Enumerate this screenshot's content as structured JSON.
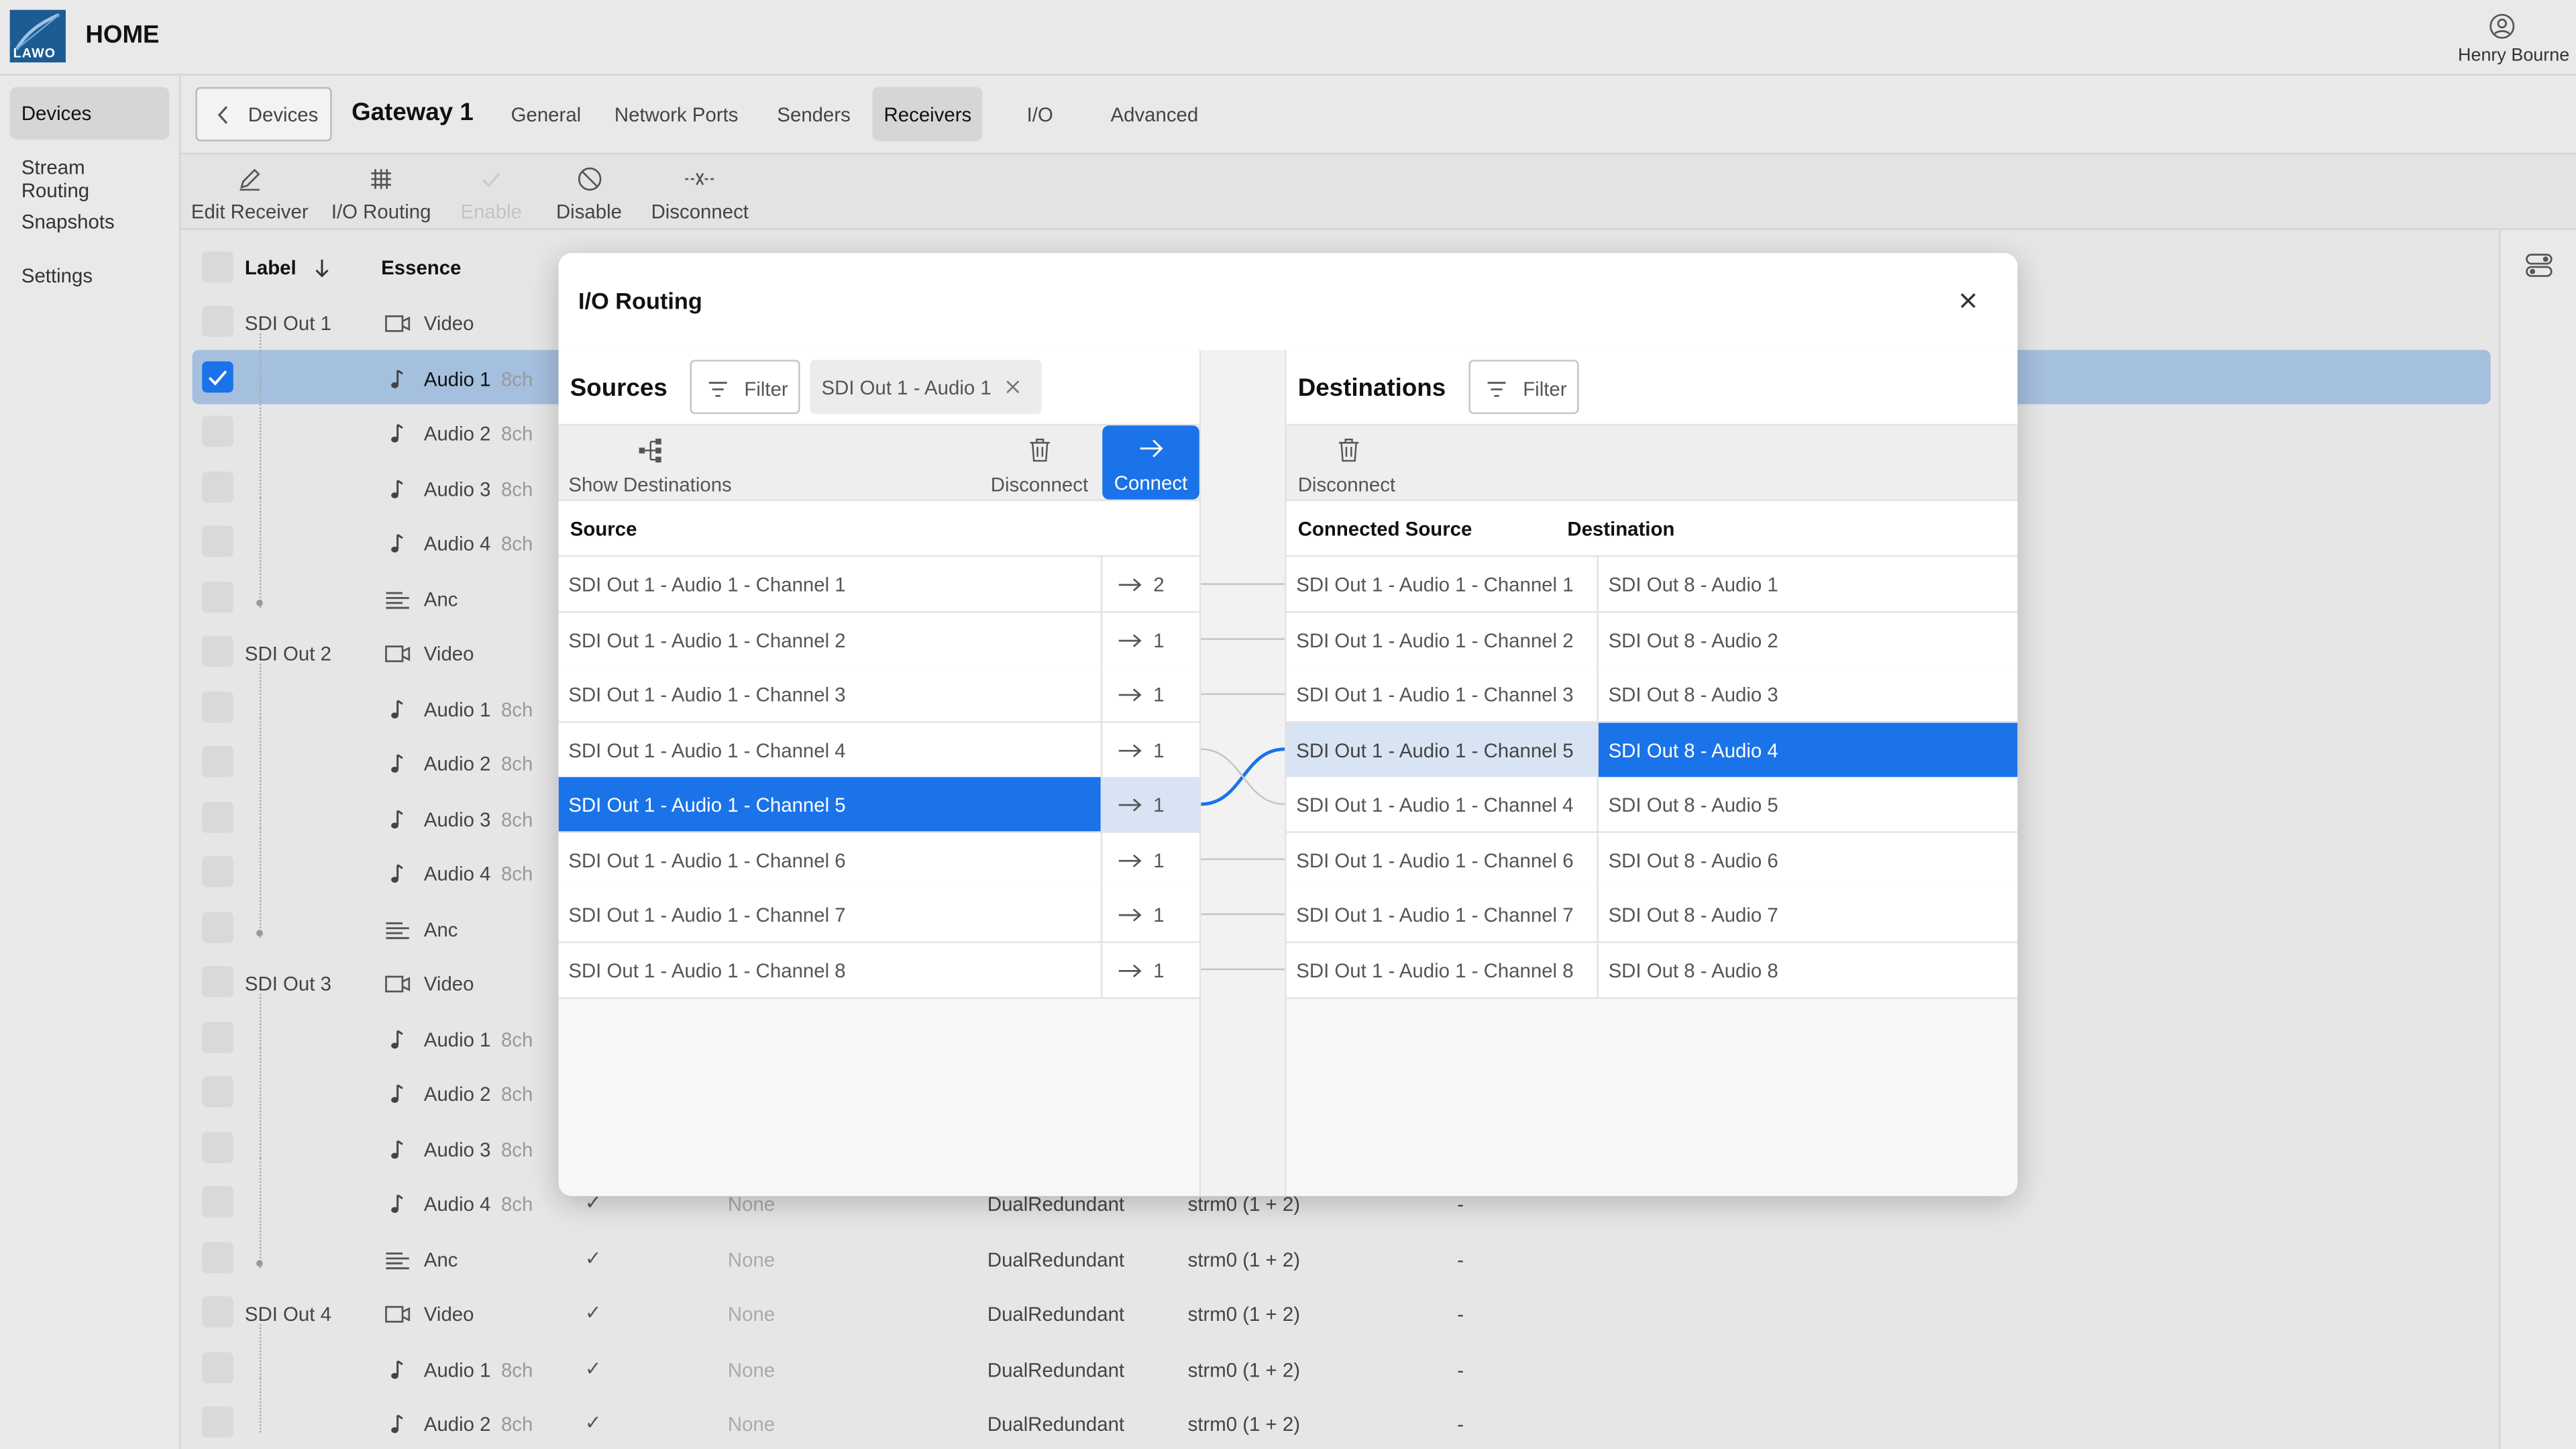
{
  "app": {
    "home_label": "HOME",
    "logo_text": "LAWO",
    "user_name": "Henry Bourne",
    "accent": "#1a73e8",
    "logo_color": "#1c5c93"
  },
  "sidebar": {
    "items": [
      {
        "label": "Devices",
        "active": true
      },
      {
        "label": "Stream Routing"
      },
      {
        "label": "Snapshots"
      },
      {
        "label": "Settings"
      }
    ]
  },
  "tabbar": {
    "back_label": "Devices",
    "device_title": "Gateway 1",
    "tabs": [
      {
        "label": "General"
      },
      {
        "label": "Network Ports"
      },
      {
        "label": "Senders"
      },
      {
        "label": "Receivers",
        "active": true
      },
      {
        "label": "I/O"
      },
      {
        "label": "Advanced"
      }
    ]
  },
  "toolbar": {
    "edit_receiver": "Edit Receiver",
    "io_routing": "I/O Routing",
    "enable": "Enable",
    "disable": "Disable",
    "disconnect": "Disconnect"
  },
  "table": {
    "headers": {
      "label": "Label",
      "essence": "Essence"
    },
    "rows": [
      {
        "label": "SDI Out 1",
        "essence": "Video"
      },
      {
        "essence": "Audio 1",
        "ch": "8ch",
        "selected": true
      },
      {
        "essence": "Audio 2",
        "ch": "8ch"
      },
      {
        "essence": "Audio 3",
        "ch": "8ch"
      },
      {
        "essence": "Audio 4",
        "ch": "8ch"
      },
      {
        "essence": "Anc"
      },
      {
        "label": "SDI Out 2",
        "essence": "Video"
      },
      {
        "essence": "Audio 1",
        "ch": "8ch"
      },
      {
        "essence": "Audio 2",
        "ch": "8ch"
      },
      {
        "essence": "Audio 3",
        "ch": "8ch"
      },
      {
        "essence": "Audio 4",
        "ch": "8ch"
      },
      {
        "essence": "Anc"
      },
      {
        "label": "SDI Out 3",
        "essence": "Video"
      },
      {
        "essence": "Audio 1",
        "ch": "8ch"
      },
      {
        "essence": "Audio 2",
        "ch": "8ch"
      },
      {
        "essence": "Audio 3",
        "ch": "8ch"
      },
      {
        "essence": "Audio 4",
        "ch": "8ch",
        "check": "✓",
        "none": "None",
        "mode": "DualRedundant",
        "stream": "strm0 (1 + 2)",
        "dash": "-"
      },
      {
        "essence": "Anc",
        "check": "✓",
        "none": "None",
        "mode": "DualRedundant",
        "stream": "strm0 (1 + 2)",
        "dash": "-"
      },
      {
        "label": "SDI Out 4",
        "essence": "Video",
        "check": "✓",
        "none": "None",
        "mode": "DualRedundant",
        "stream": "strm0 (1 + 2)",
        "dash": "-"
      },
      {
        "essence": "Audio 1",
        "ch": "8ch",
        "check": "✓",
        "none": "None",
        "mode": "DualRedundant",
        "stream": "strm0 (1 + 2)",
        "dash": "-"
      },
      {
        "essence": "Audio 2",
        "ch": "8ch",
        "check": "✓",
        "none": "None",
        "mode": "DualRedundant",
        "stream": "strm0 (1 + 2)",
        "dash": "-"
      }
    ]
  },
  "dialog": {
    "title": "I/O Routing",
    "sources": {
      "title": "Sources",
      "filter_label": "Filter",
      "chip_label": "SDI Out 1 - Audio 1",
      "show_destinations": "Show Destinations",
      "disconnect": "Disconnect",
      "connect": "Connect",
      "col_source": "Source",
      "rows": [
        {
          "name": "SDI Out 1 - Audio 1 - Channel 1",
          "count": "2"
        },
        {
          "name": "SDI Out 1 - Audio 1 - Channel 2",
          "count": "1"
        },
        {
          "name": "SDI Out 1 - Audio 1 - Channel 3",
          "count": "1"
        },
        {
          "name": "SDI Out 1 - Audio 1 - Channel 4",
          "count": "1"
        },
        {
          "name": "SDI Out 1 - Audio 1 - Channel 5",
          "count": "1",
          "selected": true
        },
        {
          "name": "SDI Out 1 - Audio 1 - Channel 6",
          "count": "1"
        },
        {
          "name": "SDI Out 1 - Audio 1 - Channel 7",
          "count": "1"
        },
        {
          "name": "SDI Out 1 - Audio 1 - Channel 8",
          "count": "1"
        }
      ]
    },
    "destinations": {
      "title": "Destinations",
      "filter_label": "Filter",
      "disconnect": "Disconnect",
      "col_connected": "Connected Source",
      "col_destination": "Destination",
      "rows": [
        {
          "connected": "SDI Out 1 - Audio 1 - Channel 1",
          "dest": "SDI Out 8 - Audio 1"
        },
        {
          "connected": "SDI Out 1 - Audio 1 - Channel 2",
          "dest": "SDI Out 8 - Audio 2"
        },
        {
          "connected": "SDI Out 1 - Audio 1 - Channel 3",
          "dest": "SDI Out 8 - Audio 3"
        },
        {
          "connected": "SDI Out 1 - Audio 1 - Channel 5",
          "dest": "SDI Out 8 - Audio 4",
          "selected": true
        },
        {
          "connected": "SDI Out 1 - Audio 1 - Channel 4",
          "dest": "SDI Out 8 - Audio 5"
        },
        {
          "connected": "SDI Out 1 - Audio 1 - Channel 6",
          "dest": "SDI Out 8 - Audio 6"
        },
        {
          "connected": "SDI Out 1 - Audio 1 - Channel 7",
          "dest": "SDI Out 8 - Audio 7"
        },
        {
          "connected": "SDI Out 1 - Audio 1 - Channel 8",
          "dest": "SDI Out 8 - Audio 8"
        }
      ]
    }
  }
}
